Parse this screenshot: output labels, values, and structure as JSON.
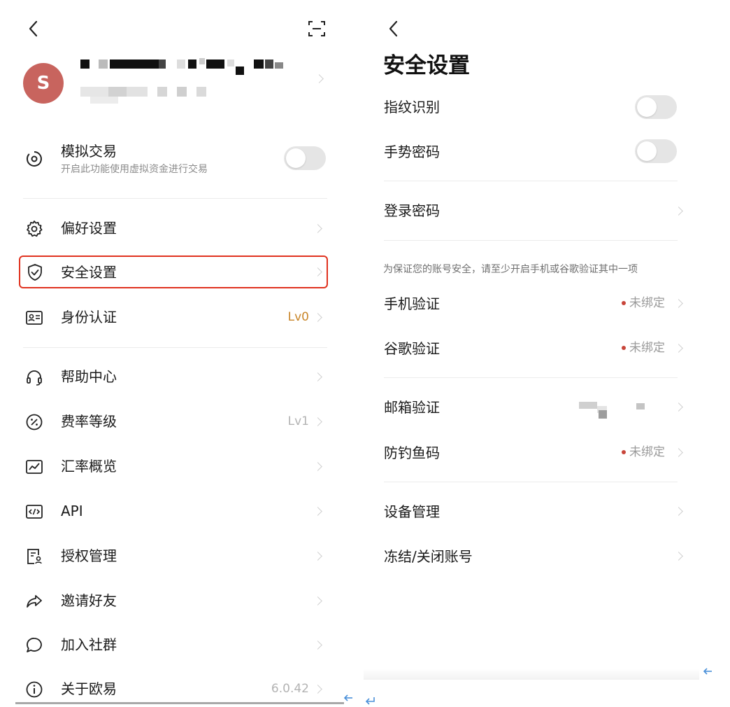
{
  "left": {
    "profile": {
      "avatar_letter": "S"
    },
    "demo": {
      "label": "模拟交易",
      "desc": "开启此功能使用虚拟资金进行交易",
      "enabled": false
    },
    "menu": [
      {
        "label": "偏好设置",
        "value": ""
      },
      {
        "label": "安全设置",
        "value": ""
      },
      {
        "label": "身份认证",
        "value": "Lv0"
      },
      {
        "label": "帮助中心",
        "value": ""
      },
      {
        "label": "费率等级",
        "value": "Lv1"
      },
      {
        "label": "汇率概览",
        "value": ""
      },
      {
        "label": "API",
        "value": ""
      },
      {
        "label": "授权管理",
        "value": ""
      },
      {
        "label": "邀请好友",
        "value": ""
      },
      {
        "label": "加入社群",
        "value": ""
      },
      {
        "label": "关于欧易",
        "value": "6.0.42"
      }
    ]
  },
  "right": {
    "title": "安全设置",
    "fingerprint": {
      "label": "指纹识别",
      "enabled": false
    },
    "gesture": {
      "label": "手势密码",
      "enabled": false
    },
    "login_password": {
      "label": "登录密码"
    },
    "notice": "为保证您的账号安全，请至少开启手机或谷歌验证其中一项",
    "phone": {
      "label": "手机验证",
      "status": "未绑定"
    },
    "google": {
      "label": "谷歌验证",
      "status": "未绑定"
    },
    "email": {
      "label": "邮箱验证"
    },
    "anti_phishing": {
      "label": "防钓鱼码",
      "status": "未绑定"
    },
    "devices": {
      "label": "设备管理"
    },
    "freeze": {
      "label": "冻结/关闭账号"
    }
  },
  "colors": {
    "highlight_border": "#e0321f",
    "level_orange": "#c9862a",
    "avatar_bg": "#c8645e",
    "status_dot": "#c8453a",
    "link_blue": "#4a90d9"
  }
}
